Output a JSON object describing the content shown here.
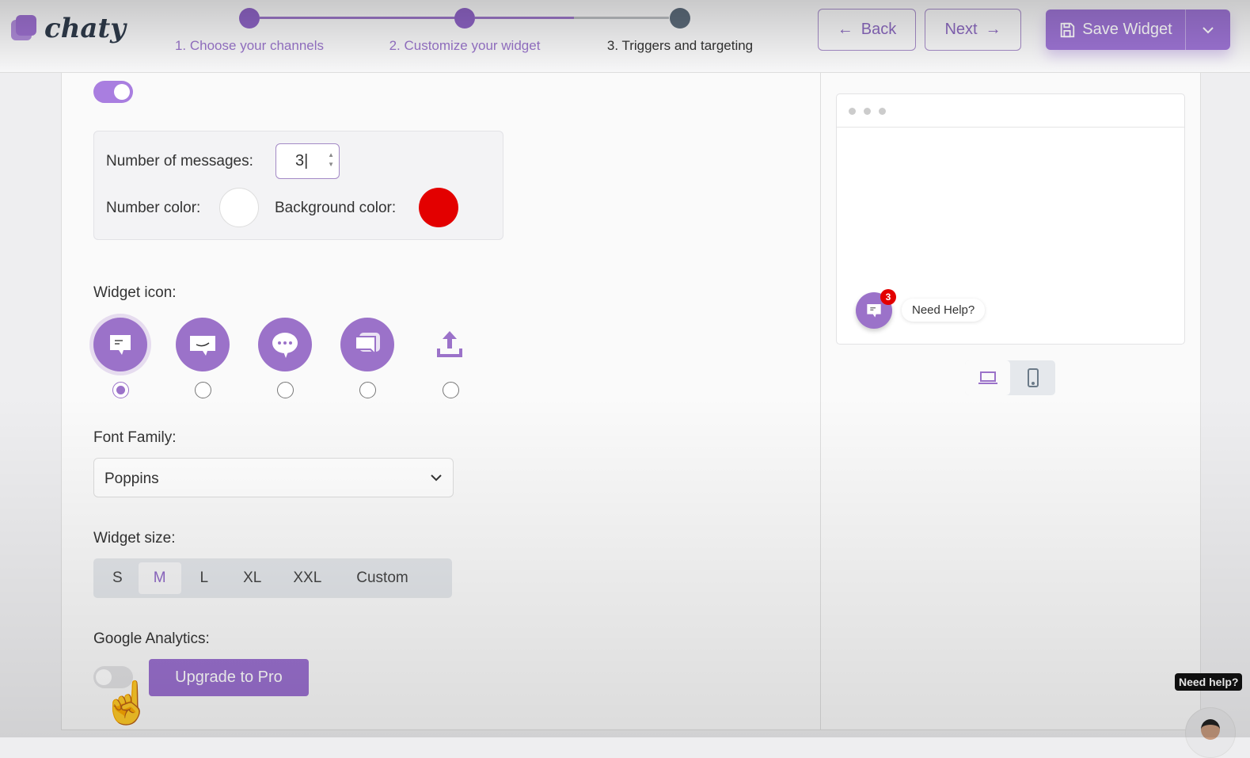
{
  "header": {
    "logo_text": "chaty",
    "steps": [
      {
        "label": "1. Choose your channels",
        "state": "done"
      },
      {
        "label": "2. Customize your widget",
        "state": "active"
      },
      {
        "label": "3. Triggers and targeting",
        "state": "upcoming"
      }
    ],
    "back_label": "Back",
    "next_label": "Next",
    "save_label": "Save Widget"
  },
  "settings": {
    "pending_messages_enabled": true,
    "number_of_messages_label": "Number of messages:",
    "number_of_messages_value": "3",
    "number_color_label": "Number color:",
    "number_color": "#ffffff",
    "background_color_label": "Background color:",
    "background_color": "#e30000",
    "widget_icon_label": "Widget icon:",
    "widget_icons": [
      "chat-bubble",
      "smile-bubble",
      "dots-bubble",
      "double-bubble",
      "upload"
    ],
    "selected_icon_index": 0,
    "font_family_label": "Font Family:",
    "font_family_value": "Poppins",
    "widget_size_label": "Widget size:",
    "sizes": [
      "S",
      "M",
      "L",
      "XL",
      "XXL",
      "Custom"
    ],
    "selected_size": "M",
    "google_analytics_label": "Google Analytics:",
    "google_analytics_enabled": false,
    "upgrade_label": "Upgrade to Pro"
  },
  "preview": {
    "badge_count": "3",
    "cta_text": "Need Help?"
  },
  "support": {
    "tooltip": "Need help?"
  },
  "colors": {
    "accent": "#9b72c9",
    "badge": "#e30000"
  }
}
